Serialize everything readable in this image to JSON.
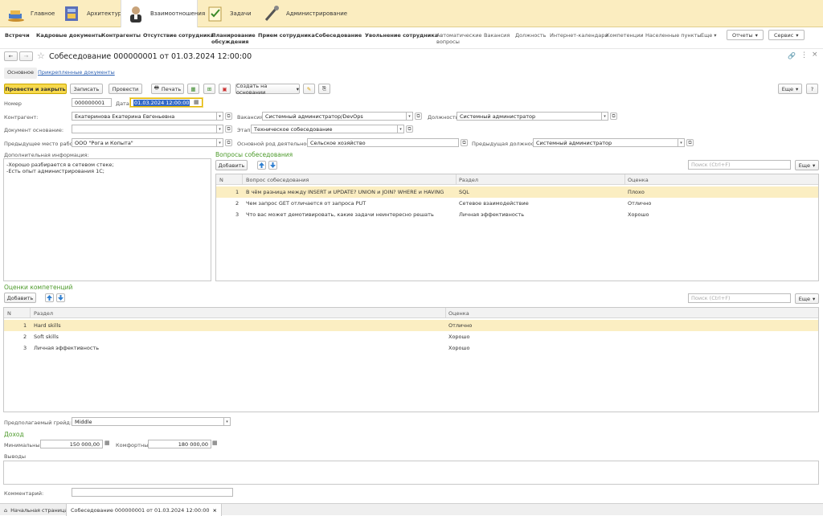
{
  "sections": [
    {
      "label": "Главное",
      "icon": "home-icon"
    },
    {
      "label": "Архитектура",
      "icon": "architecture-icon"
    },
    {
      "label": "Взаимоотношения",
      "icon": "people-icon"
    },
    {
      "label": "Задачи",
      "icon": "tasks-icon"
    },
    {
      "label": "Администрирование",
      "icon": "admin-icon"
    }
  ],
  "commands": [
    "Встречи",
    "Кадровые документы",
    "Контрагенты",
    "Отсутствие сотрудника",
    "Планирование обсуждения",
    "Прием сотрудника",
    "Собеседование",
    "Увольнение сотрудника",
    "Автоматические вопросы",
    "Вакансия",
    "Должность",
    "Интернет-календари",
    "Компетенции",
    "Населенные пункты"
  ],
  "commands_more": "Еще",
  "menu_reports": "Отчеты",
  "menu_service": "Сервис",
  "doc_title": "Собеседование 000000001 от 01.03.2024 12:00:00",
  "form_tabs": {
    "main": "Основное",
    "attached": "Прикрепленные документы"
  },
  "toolbar": {
    "post_close": "Провести и закрыть",
    "save": "Записать",
    "post": "Провести",
    "print": "Печать",
    "create_based": "Создать на основании",
    "more": "Еще",
    "help": "?"
  },
  "fields": {
    "number_label": "Номер",
    "number": "000000001",
    "date_label": "Дата:",
    "date": "01.03.2024 12:00:00",
    "counterparty_label": "Контрагент:",
    "counterparty": "Екатеринова Екатерина Евгеньевна",
    "vacancy_label": "Вакансия:",
    "vacancy": "Системный администратор/DevOps",
    "position_label": "Должность:",
    "position": "Системный администратор",
    "basis_label": "Документ основание:",
    "basis": "",
    "stage_label": "Этап:",
    "stage": "Техническое собеседование",
    "prev_job_label": "Предыдущее место работы:",
    "prev_job": "ООО \"Рога и Копыта\"",
    "activity_label": "Основной род деятельности:",
    "activity": "Сельское хозяйство",
    "prev_position_label": "Предыдущая должность:",
    "prev_position": "Системный администратор"
  },
  "additional": {
    "label": "Дополнительная информация:",
    "line1": "-Хорошо разбирается в сетевом стеке;",
    "line2": "-Есть опыт администрирования 1С;"
  },
  "questions": {
    "title": "Вопросы собеседования",
    "add": "Добавить",
    "search": "Поиск (Ctrl+F)",
    "more": "Еще",
    "headers": [
      "N",
      "Вопрос собеседования",
      "Раздел",
      "Оценка"
    ],
    "rows": [
      [
        "1",
        "В чём разница между INSERT и UPDATE? UNION и JOIN? WHERE и HAVING",
        "SQL",
        "Плохо"
      ],
      [
        "2",
        "Чем запрос GET отличается от запроса PUT",
        "Сетевое взаимодействие",
        "Отлично"
      ],
      [
        "3",
        "Что вас может демотивировать, какие задачи неинтересно решать",
        "Личная эффективность",
        "Хорошо"
      ]
    ]
  },
  "competencies": {
    "title": "Оценки компетенций",
    "add": "Добавить",
    "search": "Поиск (Ctrl+F)",
    "more": "Еще",
    "headers": [
      "N",
      "Раздел",
      "Оценка"
    ],
    "rows": [
      [
        "1",
        "Hard skills",
        "Отлично"
      ],
      [
        "2",
        "Soft skills",
        "Хорошо"
      ],
      [
        "3",
        "Личная эффективность",
        "Хорошо"
      ]
    ]
  },
  "grade": {
    "label": "Предполагаемый грейд:",
    "value": "Middle"
  },
  "income": {
    "title": "Доход",
    "min_label": "Минимальный:",
    "min": "150 000,00",
    "comfort_label": "Комфортный:",
    "comfort": "180 000,00"
  },
  "conclusions_label": "Выводы",
  "comment_label": "Комментарий:",
  "bottom": {
    "home": "Начальная страница",
    "doc": "Собеседование 000000001 от 01.03.2024 12:00:00"
  }
}
